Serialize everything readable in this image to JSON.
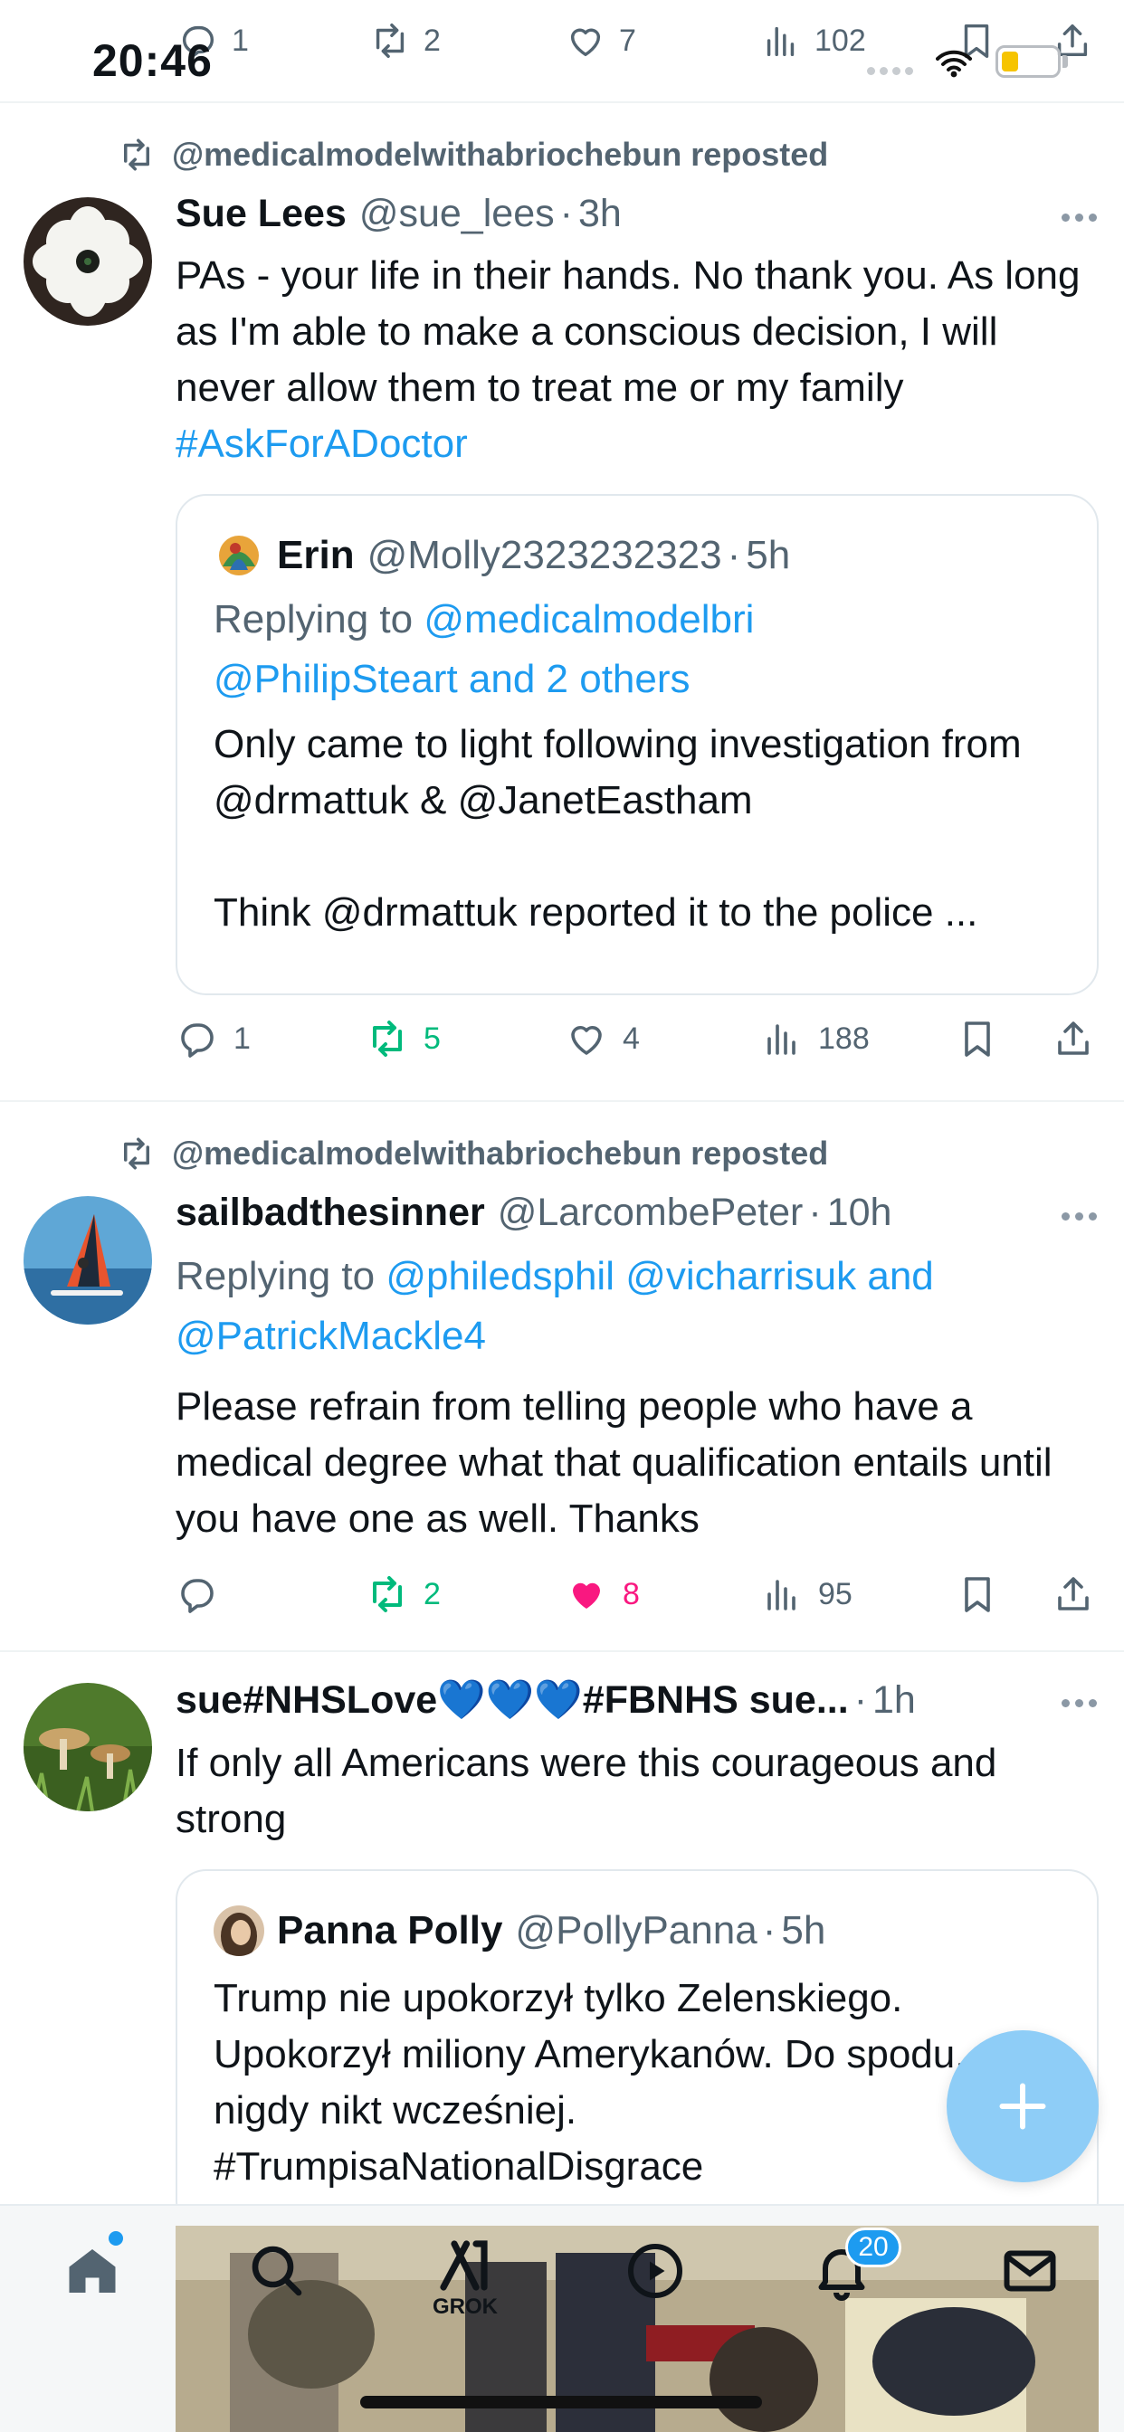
{
  "status_bar": {
    "time": "20:46"
  },
  "top_actions": {
    "replies": "1",
    "reposts": "2",
    "likes": "7",
    "views": "102"
  },
  "posts": [
    {
      "repost_label": "@medicalmodelwithabriochebun reposted",
      "author": "Sue Lees",
      "handle": "@sue_lees",
      "time": "3h",
      "text_plain": "PAs -  your life in their hands.  No thank you. As long as I'm able to make a conscious decision, I will never allow them to treat me or my family",
      "hashtag": "#AskForADoctor",
      "quote": {
        "author": "Erin",
        "handle": "@Molly2323232323",
        "time": "5h",
        "replying_prefix": "Replying to",
        "replying_link1": "@medicalmodelbri",
        "replying_link2": "@PhilipSteart and 2 others",
        "text": "Only came to light following investigation from @drmattuk & @JanetEastham\n\nThink @drmattuk reported it to the police ..."
      },
      "actions": {
        "replies": "1",
        "reposts": "5",
        "likes": "4",
        "views": "188"
      }
    },
    {
      "repost_label": "@medicalmodelwithabriochebun reposted",
      "author": "sailbadthesinner",
      "handle": "@LarcombePeter",
      "time": "10h",
      "replying_prefix": "Replying to",
      "replying_link1": "@philedsphil @vicharrisuk and",
      "replying_link2": "@PatrickMackle4",
      "text": "Please refrain from telling people who have a medical degree what that qualification entails until you have one as well. Thanks",
      "actions": {
        "replies": "",
        "reposts": "2",
        "likes": "8",
        "views": "95"
      }
    },
    {
      "author": "sue#NHSLove💙💙💙#FBNHS sue...",
      "time": "1h",
      "text": "If only all Americans were this courageous and strong",
      "quote": {
        "author": "Panna Polly",
        "handle": "@PollyPanna",
        "time": "5h",
        "text": "Trump nie upokorzył tylko Zelenskiego. Upokorzył miliony Amerykanów. Do spodu. Jak nigdy nikt wcześniej. #TrumpisaNationalDisgrace"
      }
    }
  ],
  "tab_bar": {
    "grok_label": "GROK",
    "notifications_badge": "20"
  },
  "colors": {
    "accent": "#1d9bf0",
    "repost_green": "#00ba7c",
    "like_pink": "#f91880",
    "muted": "#536471"
  }
}
